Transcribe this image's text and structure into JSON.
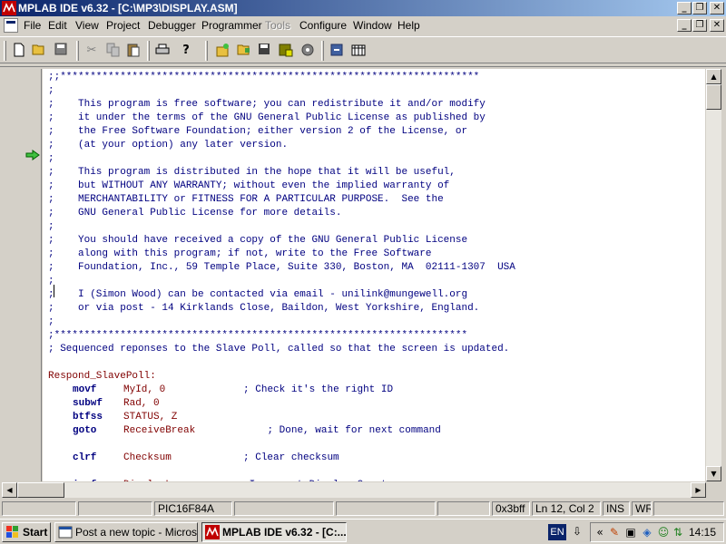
{
  "window": {
    "title": "MPLAB IDE v6.32 - [C:\\MP3\\DISPLAY.ASM]",
    "minimize": "_",
    "restore": "❐",
    "close": "✕"
  },
  "menu": {
    "items": [
      "File",
      "Edit",
      "View",
      "Project",
      "Debugger",
      "Programmer",
      "Tools",
      "Configure",
      "Window",
      "Help"
    ],
    "disabled": [
      "Tools"
    ]
  },
  "toolbar": {
    "buttons": [
      "new-file",
      "open-file",
      "save-file",
      "cut",
      "copy",
      "paste",
      "print",
      "help",
      "new-project",
      "open-project",
      "save-project",
      "build",
      "make",
      "import",
      "workspace"
    ]
  },
  "editor": {
    "lines": [
      {
        "type": "comment",
        "text": ";;**********************************************************************"
      },
      {
        "type": "comment",
        "text": ";"
      },
      {
        "type": "comment",
        "text": ";    This program is free software; you can redistribute it and/or modify"
      },
      {
        "type": "comment",
        "text": ";    it under the terms of the GNU General Public License as published by"
      },
      {
        "type": "comment",
        "text": ";    the Free Software Foundation; either version 2 of the License, or"
      },
      {
        "type": "comment",
        "text": ";    (at your option) any later version."
      },
      {
        "type": "comment",
        "text": ";"
      },
      {
        "type": "comment",
        "text": ";    This program is distributed in the hope that it will be useful,"
      },
      {
        "type": "comment",
        "text": ";    but WITHOUT ANY WARRANTY; without even the implied warranty of"
      },
      {
        "type": "comment",
        "text": ";    MERCHANTABILITY or FITNESS FOR A PARTICULAR PURPOSE.  See the"
      },
      {
        "type": "comment",
        "text": ";    GNU General Public License for more details."
      },
      {
        "type": "comment",
        "text": ";"
      },
      {
        "type": "comment",
        "text": ";    You should have received a copy of the GNU General Public License"
      },
      {
        "type": "comment",
        "text": ";    along with this program; if not, write to the Free Software"
      },
      {
        "type": "comment",
        "text": ";    Foundation, Inc., 59 Temple Place, Suite 330, Boston, MA  02111-1307  USA"
      },
      {
        "type": "comment",
        "text": ";"
      },
      {
        "type": "comment",
        "text": ";    I (Simon Wood) can be contacted via email - unilink@mungewell.org"
      },
      {
        "type": "comment",
        "text": ";    or via post - 14 Kirklands Close, Baildon, West Yorkshire, England."
      },
      {
        "type": "comment",
        "text": ";"
      },
      {
        "type": "comment",
        "text": ";*********************************************************************"
      },
      {
        "type": "comment",
        "text": "; Sequenced reponses to the Slave Poll, called so that the screen is updated."
      },
      {
        "type": "blank",
        "text": ""
      },
      {
        "type": "label",
        "text": "Respond_SlavePoll:"
      },
      {
        "type": "instr",
        "op": "movf",
        "args": "MyId, 0",
        "pad": "             ",
        "comment": "; Check it's the right ID"
      },
      {
        "type": "instr",
        "op": "subwf",
        "args": "Rad, 0",
        "pad": "",
        "comment": ""
      },
      {
        "type": "instr",
        "op": "btfss",
        "args": "STATUS, Z",
        "pad": "",
        "comment": ""
      },
      {
        "type": "instr",
        "op": "goto",
        "args": "ReceiveBreak",
        "pad": "            ",
        "comment": "; Done, wait for next command"
      },
      {
        "type": "blank",
        "text": ""
      },
      {
        "type": "instr",
        "op": "clrf",
        "args": "Checksum",
        "pad": "            ",
        "comment": "; Clear checksum"
      },
      {
        "type": "blank",
        "text": ""
      },
      {
        "type": "instr",
        "op": "incf",
        "args": "DisplayLoop",
        "pad": "        ",
        "comment": "; Increment Display Count"
      }
    ]
  },
  "status": {
    "panes": [
      "",
      "",
      "PIC16F84A",
      "",
      "",
      "",
      "0x3bff",
      "Ln 12, Col 2",
      "INS",
      "WR",
      ""
    ]
  },
  "taskbar": {
    "start": "Start",
    "tasks": [
      {
        "label": "Post a new topic - Micros...",
        "active": false
      },
      {
        "label": "MPLAB IDE v6.32 - [C:...",
        "active": true
      }
    ],
    "lang": "EN",
    "clock": "14:15"
  }
}
